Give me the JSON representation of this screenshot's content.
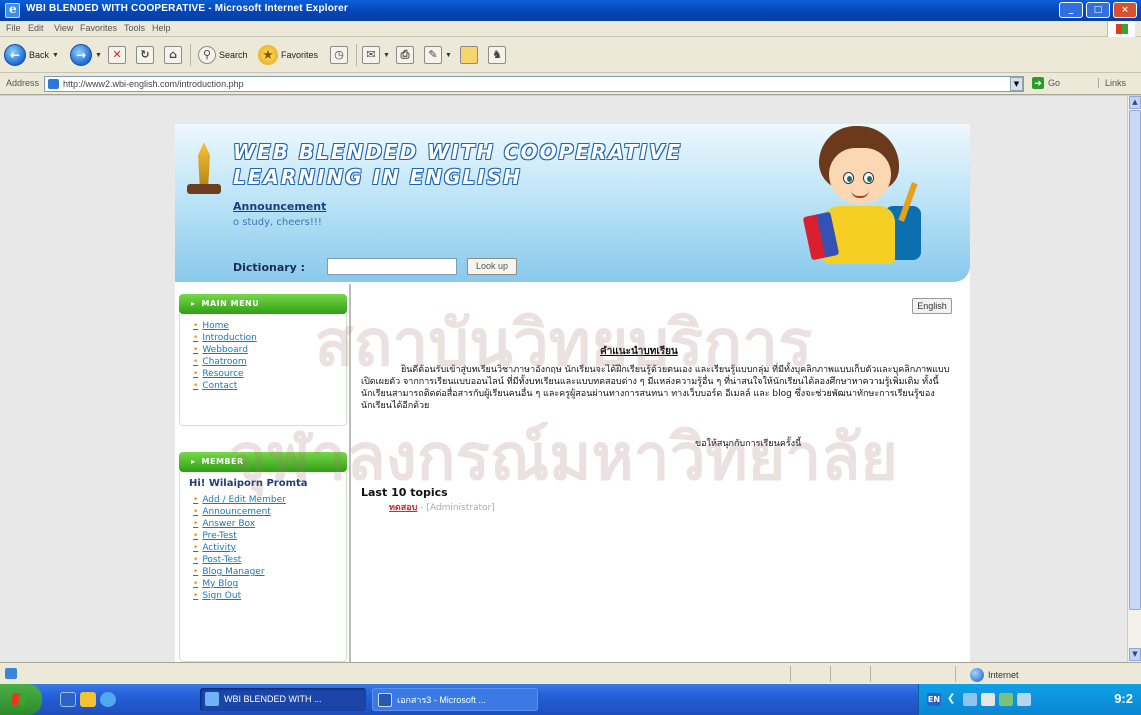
{
  "window": {
    "title": "WBI BLENDED WITH COOPERATIVE - Microsoft Internet Explorer",
    "buttons": [
      "_",
      "□",
      "×"
    ]
  },
  "menubar": [
    "File",
    "Edit",
    "View",
    "Favorites",
    "Tools",
    "Help"
  ],
  "toolbar": {
    "back": "Back",
    "search": "Search",
    "favorites": "Favorites"
  },
  "address": {
    "label": "Address",
    "url": "http://www2.wbi-english.com/introduction.php",
    "go": "Go",
    "links": "Links"
  },
  "watermark": [
    "สถาบันวิทยบริการ",
    "จุฬาลงกรณ์มหาวิทยาลัย"
  ],
  "header": {
    "site_title_line1": "WEB BLENDED WITH COOPERATIVE",
    "site_title_line2": "LEARNING IN ENGLISH",
    "announcement_title": "Announcement",
    "announcement_text": "o study, cheers!!!",
    "dictionary_label": "Dictionary :",
    "dictionary_value": "",
    "lookup_label": "Look up"
  },
  "main_menu": {
    "heading": "MAIN MENU",
    "items": [
      "Home",
      "Introduction",
      "Webboard",
      "Chatroom",
      "Resource",
      "Contact"
    ]
  },
  "member_menu": {
    "heading": "MEMBER",
    "greeting": "Hi! Wilaiporn Promta",
    "items": [
      "Add / Edit Member",
      "Announcement",
      "Answer Box",
      "Pre-Test",
      "Activity",
      "Post-Test",
      "Blog Manager",
      "My Blog",
      "Sign Out"
    ]
  },
  "content": {
    "lang_button": "English",
    "title": "คำแนะนำบทเรียน",
    "body": "ยินดีต้อนรับเข้าสู่บทเรียนวิชาภาษาอังกฤษ นักเรียนจะได้ฝึกเรียนรู้ด้วยตนเอง และเรียนรู้แบบกลุ่ม ที่มีทั้งบุคลิกภาพแบบเก็บตัวและบุคลิกภาพแบบเปิดเผยตัว จากการเรียนแบบออนไลน์ ที่มีทั้งบทเรียนและแบบทดสอบต่าง ๆ มีแหล่งความรู้อื่น ๆ ที่น่าสนใจให้นักเรียนได้ลองศึกษาหาความรู้เพิ่มเติม ทั้งนี้นักเรียนสามารถติดต่อสื่อสารกับผู้เรียนคนอื่น ๆ และครูผู้สอนผ่านทางการสนทนา ทางเว็บบอร์ด อีเมลล์ และ blog ซึ่งจะช่วยพัฒนาทักษะการเรียนรู้ของนักเรียนได้อีกด้วย",
    "closing": "ขอให้สนุกกับการเรียนครั้งนี้",
    "topics_title": "Last 10 topics",
    "topic_link": "ทดสอบ",
    "topic_author": " - [Administrator]"
  },
  "statusbar": {
    "zone": "Internet"
  },
  "taskbar": {
    "tasks": [
      "WBI BLENDED WITH ...",
      "เอกสาร3 - Microsoft ..."
    ],
    "tray_lang": "EN",
    "clock": "9:2"
  },
  "colors": {
    "menu_green": "#2f9f14",
    "link_blue": "#1a7ab7",
    "title_blue": "#1d66b8",
    "header_sky": "#89c9ec"
  },
  "icons": [
    "back-icon",
    "forward-icon",
    "stop-icon",
    "refresh-icon",
    "home-icon",
    "search-icon",
    "favorites-icon",
    "history-icon",
    "mail-icon",
    "print-icon",
    "edit-icon",
    "folder-icon",
    "messenger-icon"
  ]
}
